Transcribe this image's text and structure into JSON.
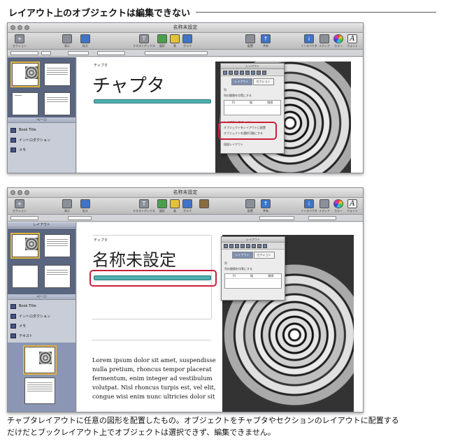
{
  "heading": "レイアウト上のオブジェクトは編集できない",
  "screenshots": [
    {
      "window_title": "名称未設定",
      "toolbar_left": [
        {
          "icon": "plus-icon",
          "label": "セクション"
        },
        {
          "icon": "view-icon",
          "label": "表示"
        },
        {
          "icon": "zoom-icon",
          "label": "拡大"
        }
      ],
      "toolbar_center": [
        {
          "icon": "textbox-icon",
          "label": "テキストボックス"
        },
        {
          "icon": "shape-icon",
          "label": "図形"
        },
        {
          "icon": "table-icon",
          "label": "表"
        },
        {
          "icon": "chart-icon",
          "label": "グラフ"
        }
      ],
      "toolbar_right": [
        {
          "icon": "arrange-icon",
          "label": "配置"
        },
        {
          "icon": "share-icon",
          "label": "共有"
        },
        {
          "icon": "inspector-icon",
          "label": "インスペクタ"
        },
        {
          "icon": "media-icon",
          "label": "メディア"
        },
        {
          "icon": "colors-icon",
          "label": "カラー"
        },
        {
          "icon": "fonts-icon",
          "label": "フォント"
        }
      ],
      "sidebar_section_label": "ページ",
      "sidebar_items": [
        "Book Title",
        "イントロダクション",
        "メモ"
      ],
      "chapter_small": "チャプタ",
      "chapter_title": "チャプタ",
      "inspector": {
        "title": "レイアウト",
        "tabs": [
          "レイアウト",
          "セクション"
        ],
        "row1": "列",
        "row2": "列の間隔を均等にする",
        "table_headers": [
          "列",
          "幅",
          "間隔"
        ],
        "section_label": "レイアウトのマージン",
        "highlight_line1": "オブジェクトをレイアウトに配置",
        "highlight_line2": "オブジェクトを選択可能にする",
        "footer": "段組レイアウト"
      }
    },
    {
      "window_title": "名称未設定",
      "sidebar_section_top": "レイアウト",
      "sidebar_section_mid": "ページ",
      "sidebar_items": [
        "Book Title",
        "イントロダクション",
        "メモ",
        "テキスト"
      ],
      "chapter_small": "チャプタ",
      "chapter_title": "名称未設定",
      "body_text": [
        "Lorem ipsum dolor sit amet, suspendisse",
        "nulla pretium, rhoncus tempor placerat",
        "fermentum, enim integer ad vestibulum",
        "volutpat. Nisl rhoncus turpis est, vel elit,",
        "congue wisi enim nunc ultricies dolor sit,"
      ],
      "inspector": {
        "title": "レイアウト",
        "tabs": [
          "レイアウト",
          "セクション"
        ],
        "row1": "列",
        "row2": "列の間隔を均等にする",
        "table_headers": [
          "列",
          "幅",
          "間隔"
        ]
      }
    }
  ],
  "caption_line1": "チャプタレイアウトに任意の図形を配置したもの。オブジェクトをチャプタやセクションのレイアウトに配置する",
  "caption_line2": "だけだとブックレイアウト上でオブジェクトは選択できず、編集できません。"
}
